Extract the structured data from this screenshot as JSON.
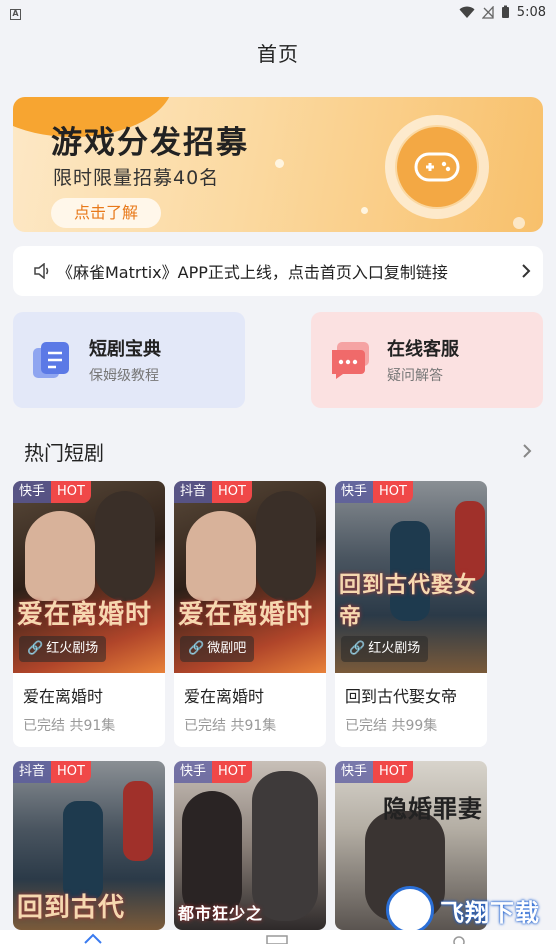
{
  "status_bar": {
    "time": "5:08",
    "notification_badge": "A"
  },
  "page": {
    "title": "首页"
  },
  "banner": {
    "title": "游戏分发招募",
    "subtitle": "限时限量招募40名",
    "cta": "点击了解",
    "icon": "gamepad-icon"
  },
  "notice": {
    "icon": "speaker-icon",
    "text": "《麻雀Matrtix》APP正式上线，点击首页入口复制链接"
  },
  "features": [
    {
      "title": "短剧宝典",
      "subtitle": "保姆级教程",
      "icon": "document-icon",
      "color": "#5b79e6"
    },
    {
      "title": "在线客服",
      "subtitle": "疑问解答",
      "icon": "chat-icon",
      "color": "#f06a6a"
    }
  ],
  "section": {
    "title": "热门短剧"
  },
  "dramas": [
    {
      "platform": "快手",
      "hot": "HOT",
      "studio": "红火剧场",
      "poster_text": "爱在离婚时",
      "name": "爱在离婚时",
      "meta": "已完结 共91集"
    },
    {
      "platform": "抖音",
      "hot": "HOT",
      "studio": "微剧吧",
      "poster_text": "爱在离婚时",
      "name": "爱在离婚时",
      "meta": "已完结 共91集"
    },
    {
      "platform": "快手",
      "hot": "HOT",
      "studio": "红火剧场",
      "poster_text": "回到古代娶女帝",
      "name": "回到古代娶女帝",
      "meta": "已完结 共99集"
    },
    {
      "platform": "抖音",
      "hot": "HOT",
      "poster_text": "回到古代"
    },
    {
      "platform": "快手",
      "hot": "HOT",
      "poster_text": "都市狂少之"
    },
    {
      "platform": "快手",
      "hot": "HOT",
      "poster_text": "隐婚罪妻"
    }
  ],
  "watermark": {
    "text": "飞翔下载"
  },
  "colors": {
    "accent": "#f7a531",
    "hot": "#f04848",
    "background": "#f2f3f7"
  }
}
